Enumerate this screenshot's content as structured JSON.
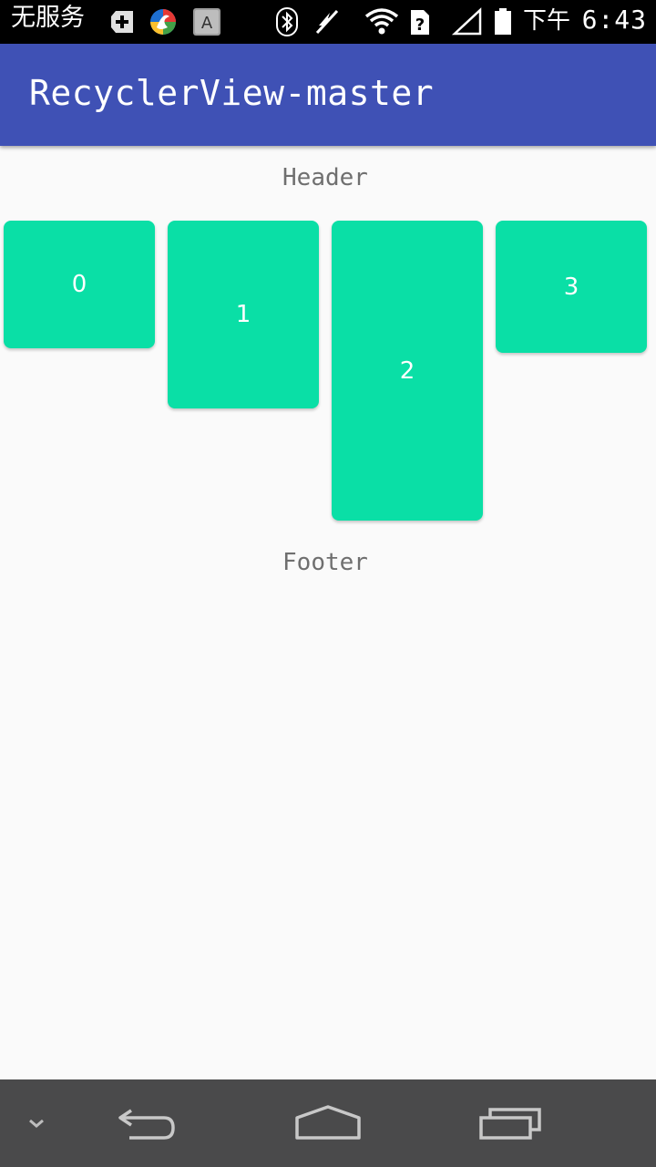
{
  "status_bar": {
    "carrier": "无服务",
    "ampm": "下午",
    "time": "6:43",
    "icons": [
      "add-notification-icon",
      "app-notification-icon",
      "keyboard-a-icon",
      "bluetooth-icon",
      "vibrate-off-icon",
      "wifi-icon",
      "sim-unknown-icon",
      "signal-icon",
      "battery-icon"
    ]
  },
  "app_bar": {
    "title": "RecyclerView-master",
    "color": "#3f51b5"
  },
  "list": {
    "header": "Header",
    "footer": "Footer",
    "item_color": "#0adfa6",
    "items": [
      {
        "label": "0"
      },
      {
        "label": "1"
      },
      {
        "label": "2"
      },
      {
        "label": "3"
      }
    ]
  },
  "nav_bar": {
    "buttons": [
      "collapse-chevron-icon",
      "back-icon",
      "home-icon",
      "recents-icon"
    ]
  }
}
